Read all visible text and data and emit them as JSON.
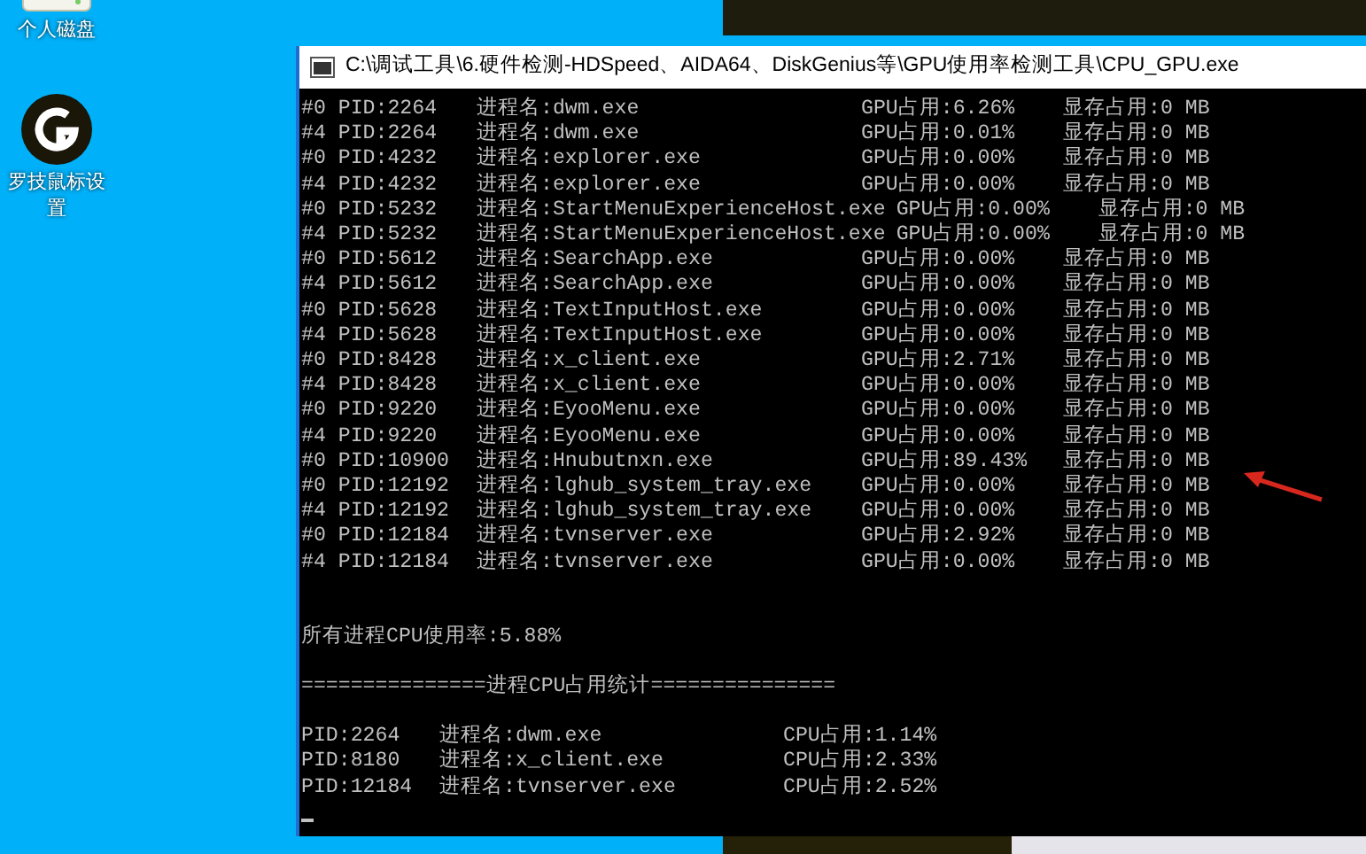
{
  "desktop_icons": [
    {
      "kind": "drive",
      "label": "个人磁盘"
    },
    {
      "kind": "logo",
      "label": "罗技鼠标设置"
    }
  ],
  "console": {
    "title": "C:\\调试工具\\6.硬件检测-HDSpeed、AIDA64、DiskGenius等\\GPU使用率检测工具\\CPU_GPU.exe",
    "gpu_rows": [
      {
        "pid": "#0 PID:2264",
        "name": "进程名:dwm.exe",
        "gpu": "GPU占用:6.26%",
        "mem": "显存占用:0 MB"
      },
      {
        "pid": "#4 PID:2264",
        "name": "进程名:dwm.exe",
        "gpu": "GPU占用:0.01%",
        "mem": "显存占用:0 MB"
      },
      {
        "pid": "#0 PID:4232",
        "name": "进程名:explorer.exe",
        "gpu": "GPU占用:0.00%",
        "mem": "显存占用:0 MB"
      },
      {
        "pid": "#4 PID:4232",
        "name": "进程名:explorer.exe",
        "gpu": "GPU占用:0.00%",
        "mem": "显存占用:0 MB"
      },
      {
        "pid": "#0 PID:5232",
        "name": "进程名:StartMenuExperienceHost.exe",
        "gpu": "GPU占用:0.00%",
        "mem": "显存占用:0 MB"
      },
      {
        "pid": "#4 PID:5232",
        "name": "进程名:StartMenuExperienceHost.exe",
        "gpu": "GPU占用:0.00%",
        "mem": "显存占用:0 MB"
      },
      {
        "pid": "#0 PID:5612",
        "name": "进程名:SearchApp.exe",
        "gpu": "GPU占用:0.00%",
        "mem": "显存占用:0 MB"
      },
      {
        "pid": "#4 PID:5612",
        "name": "进程名:SearchApp.exe",
        "gpu": "GPU占用:0.00%",
        "mem": "显存占用:0 MB"
      },
      {
        "pid": "#0 PID:5628",
        "name": "进程名:TextInputHost.exe",
        "gpu": "GPU占用:0.00%",
        "mem": "显存占用:0 MB"
      },
      {
        "pid": "#4 PID:5628",
        "name": "进程名:TextInputHost.exe",
        "gpu": "GPU占用:0.00%",
        "mem": "显存占用:0 MB"
      },
      {
        "pid": "#0 PID:8428",
        "name": "进程名:x_client.exe",
        "gpu": "GPU占用:2.71%",
        "mem": "显存占用:0 MB"
      },
      {
        "pid": "#4 PID:8428",
        "name": "进程名:x_client.exe",
        "gpu": "GPU占用:0.00%",
        "mem": "显存占用:0 MB"
      },
      {
        "pid": "#0 PID:9220",
        "name": "进程名:EyooMenu.exe",
        "gpu": "GPU占用:0.00%",
        "mem": "显存占用:0 MB"
      },
      {
        "pid": "#4 PID:9220",
        "name": "进程名:EyooMenu.exe",
        "gpu": "GPU占用:0.00%",
        "mem": "显存占用:0 MB"
      },
      {
        "pid": "#0 PID:10900",
        "name": "进程名:Hnubutnxn.exe",
        "gpu": "GPU占用:89.43%",
        "mem": "显存占用:0 MB"
      },
      {
        "pid": "#0 PID:12192",
        "name": "进程名:lghub_system_tray.exe",
        "gpu": "GPU占用:0.00%",
        "mem": "显存占用:0 MB"
      },
      {
        "pid": "#4 PID:12192",
        "name": "进程名:lghub_system_tray.exe",
        "gpu": "GPU占用:0.00%",
        "mem": "显存占用:0 MB"
      },
      {
        "pid": "#0 PID:12184",
        "name": "进程名:tvnserver.exe",
        "gpu": "GPU占用:2.92%",
        "mem": "显存占用:0 MB"
      },
      {
        "pid": "#4 PID:12184",
        "name": "进程名:tvnserver.exe",
        "gpu": "GPU占用:0.00%",
        "mem": "显存占用:0 MB"
      }
    ],
    "summary": "所有进程CPU使用率:5.88%",
    "separator": "===============进程CPU占用统计===============",
    "cpu_rows": [
      {
        "pid": "PID:2264",
        "name": "进程名:dwm.exe",
        "cpu": "CPU占用:1.14%"
      },
      {
        "pid": "PID:8180",
        "name": "进程名:x_client.exe",
        "cpu": "CPU占用:2.33%"
      },
      {
        "pid": "PID:12184",
        "name": "进程名:tvnserver.exe",
        "cpu": "CPU占用:2.52%"
      }
    ]
  }
}
